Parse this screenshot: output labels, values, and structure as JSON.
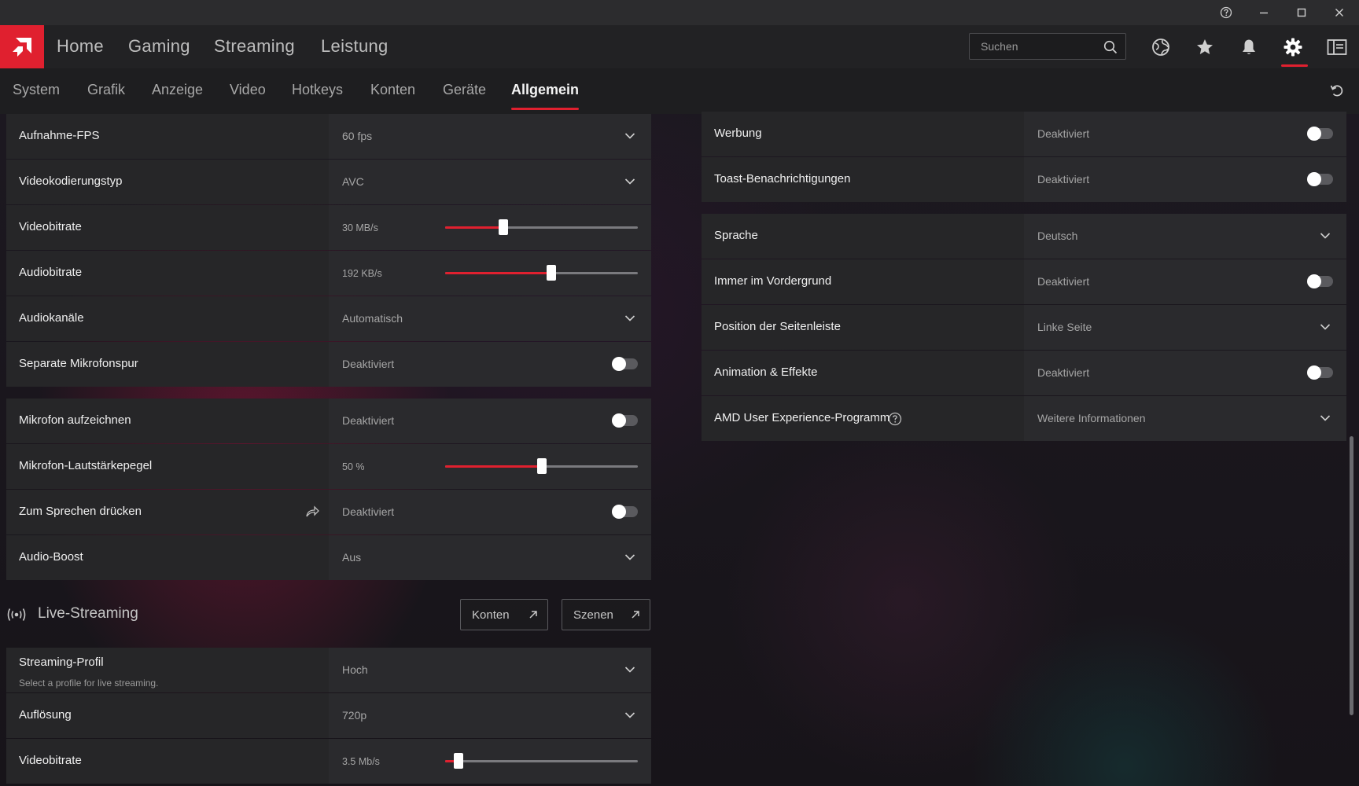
{
  "titlebar": {
    "icons": [
      "help-icon",
      "minimize-icon",
      "maximize-icon",
      "close-icon"
    ]
  },
  "main_nav": {
    "items": [
      "Home",
      "Gaming",
      "Streaming",
      "Leistung"
    ],
    "search_placeholder": "Suchen",
    "icons": [
      "globe-icon",
      "star-icon",
      "bell-icon",
      "gear-icon",
      "sidebar-toggle-icon"
    ],
    "accent": "#e0202f"
  },
  "sub_nav": {
    "tabs": [
      "System",
      "Grafik",
      "Anzeige",
      "Video",
      "Hotkeys",
      "Konten",
      "Geräte",
      "Allgemein"
    ],
    "active": "Allgemein"
  },
  "left_group1": [
    {
      "label": "Aufnahme-FPS",
      "value": "60 fps",
      "control": "dropdown"
    },
    {
      "label": "Videokodierungstyp",
      "value": "AVC",
      "control": "dropdown"
    },
    {
      "label": "Videobitrate",
      "value": "30 MB/s",
      "control": "slider",
      "level": 0.3
    },
    {
      "label": "Audiobitrate",
      "value": "192 KB/s",
      "control": "slider",
      "level": 0.55
    },
    {
      "label": "Audiokanäle",
      "value": "Automatisch",
      "control": "dropdown"
    },
    {
      "label": "Separate Mikrofonspur",
      "value": "Deaktiviert",
      "control": "toggle",
      "on": false
    }
  ],
  "left_group2": [
    {
      "label": "Mikrofon aufzeichnen",
      "value": "Deaktiviert",
      "control": "toggle",
      "on": false
    },
    {
      "label": "Mikrofon-Lautstärkepegel",
      "value": "50 %",
      "control": "slider",
      "level": 0.5
    },
    {
      "label": "Zum Sprechen drücken",
      "value": "Deaktiviert",
      "control": "toggle",
      "on": false
    },
    {
      "label": "Audio-Boost",
      "value": "Aus",
      "control": "dropdown"
    }
  ],
  "live_streaming": {
    "title": "Live-Streaming",
    "buttons": [
      "Konten",
      "Szenen"
    ],
    "rows": [
      {
        "label": "Streaming-Profil",
        "sublabel": "Select a profile for live streaming.",
        "value": "Hoch",
        "control": "dropdown"
      },
      {
        "label": "Auflösung",
        "value": "720p",
        "control": "dropdown"
      },
      {
        "label": "Videobitrate",
        "value": "3.5 Mb/s",
        "control": "slider",
        "level": 0.07
      }
    ]
  },
  "right_group1": [
    {
      "label": "Werbung",
      "value": "Deaktiviert",
      "control": "toggle",
      "on": false
    },
    {
      "label": "Toast-Benachrichtigungen",
      "value": "Deaktiviert",
      "control": "toggle",
      "on": false
    }
  ],
  "right_group2": [
    {
      "label": "Sprache",
      "value": "Deutsch",
      "control": "dropdown"
    },
    {
      "label": "Immer im Vordergrund",
      "value": "Deaktiviert",
      "control": "toggle",
      "on": false
    },
    {
      "label": "Position der Seitenleiste",
      "value": "Linke Seite",
      "control": "dropdown"
    },
    {
      "label": "Animation & Effekte",
      "value": "Deaktiviert",
      "control": "toggle",
      "on": false
    },
    {
      "label": "AMD User Experience-Programm",
      "value": "Weitere Informationen",
      "control": "dropdown"
    }
  ]
}
